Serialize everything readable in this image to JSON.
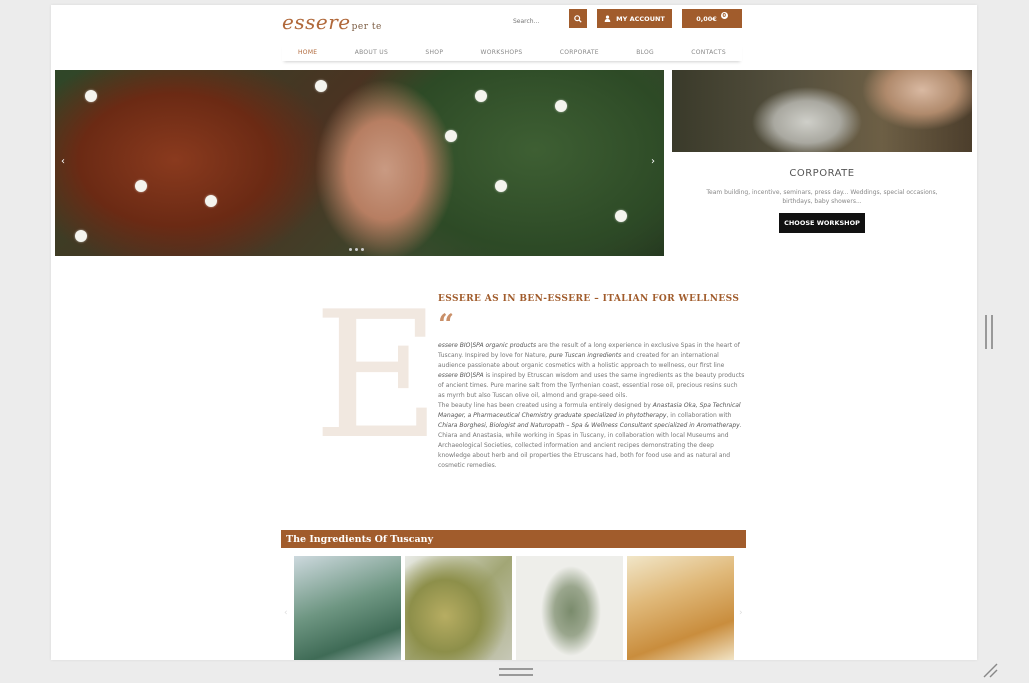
{
  "header": {
    "logo_main": "essere",
    "logo_sub": "per te",
    "search_placeholder": "Search...",
    "account_label": "MY ACCOUNT",
    "cart_total": "0,00€",
    "cart_count": "0"
  },
  "nav": {
    "items": [
      {
        "label": "HOME",
        "active": true
      },
      {
        "label": "ABOUT US"
      },
      {
        "label": "SHOP"
      },
      {
        "label": "WORKSHOPS"
      },
      {
        "label": "CORPORATE"
      },
      {
        "label": "BLOG"
      },
      {
        "label": "CONTACTS"
      }
    ]
  },
  "hero": {
    "prev_icon": "chevron-left-icon",
    "next_icon": "chevron-right-icon"
  },
  "corporate": {
    "title": "CORPORATE",
    "description": "Team building, incentive, seminars, press day... Weddings, special occasions, birthdays, baby showers...",
    "button_label": "CHOOSE WORKSHOP"
  },
  "intro": {
    "decorative_letter": "E",
    "title": "ESSERE AS IN BEN-ESSERE – ITALIAN FOR WELLNESS",
    "quote_mark": "“",
    "p1_a": "essere BIO|SPA organic products",
    "p1_b": " are the result of a long experience in exclusive Spas in the heart of Tuscany. Inspired by love for Nature, ",
    "p1_c": "pure Tuscan ingredients",
    "p1_d": " and created for an international audience passionate about organic cosmetics with a holistic approach to wellness, our first line ",
    "p1_e": "essere BIO|SPA",
    "p1_f": " is inspired by Etruscan wisdom and uses the same ingredients as the beauty products of ancient times. Pure marine salt from the Tyrrhenian coast, essential rose oil, precious resins such as myrrh but also Tuscan olive oil, almond and grape-seed oils.",
    "p2_a": "The beauty line has been created using a formula entirely designed by ",
    "p2_b": "Anastasia Oka, Spa Technical Manager, a Pharmaceutical Chemistry graduate specialized in phytotherapy",
    "p2_c": ", in collaboration with ",
    "p2_d": "Chiara Borghesi, Biologist and Naturopath – Spa & Wellness Consultant specialized in Aromatherapy",
    "p2_e": ". Chiara and Anastasia, while working in Spas in Tuscany, in collaboration with local Museums and Archaeological Societies, collected information and ancient recipes demonstrating the deep knowledge about herb and oil properties the Etruscans had, both for food use and as natural and cosmetic remedies."
  },
  "ingredients": {
    "title": "The Ingredients Of Tuscany"
  },
  "colors": {
    "brand": "#a15c2c",
    "logo": "#b0683a"
  }
}
